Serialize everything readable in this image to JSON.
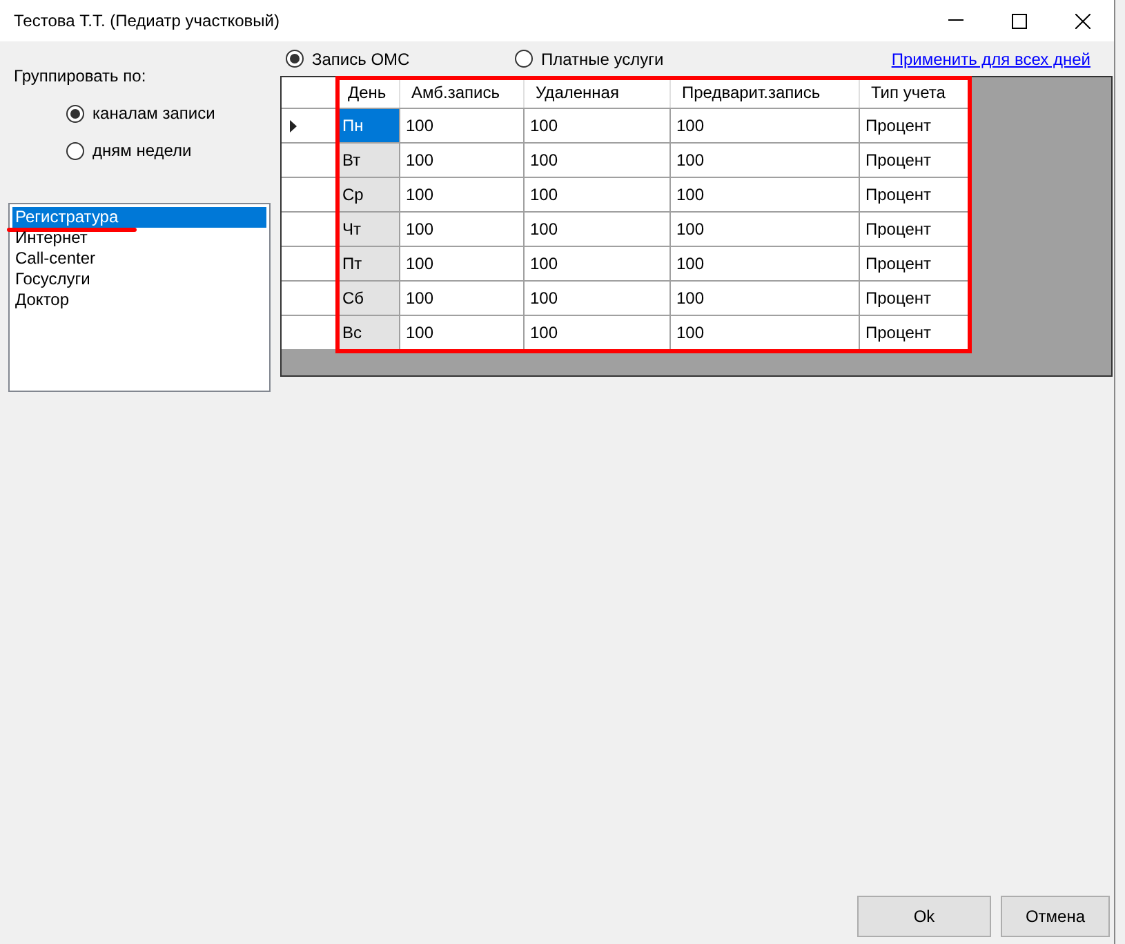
{
  "window": {
    "title": "Тестова Т.Т. (Педиатр участковый)"
  },
  "group_by": {
    "label": "Группировать по:",
    "options": [
      {
        "label": "каналам записи",
        "selected": true
      },
      {
        "label": "дням недели",
        "selected": false
      }
    ]
  },
  "channels": [
    {
      "label": "Регистратура",
      "selected": true
    },
    {
      "label": "Интернет",
      "selected": false
    },
    {
      "label": "Call-center",
      "selected": false
    },
    {
      "label": "Госуслуги",
      "selected": false
    },
    {
      "label": "Доктор",
      "selected": false
    }
  ],
  "payment": [
    {
      "label": "Запись ОМС",
      "selected": true
    },
    {
      "label": "Платные услуги",
      "selected": false
    }
  ],
  "apply_link": "Применить для всех дней",
  "table": {
    "columns": [
      "День",
      "Амб.запись",
      "Удаленная",
      "Предварит.запись",
      "Тип учета"
    ],
    "rows": [
      {
        "current": true,
        "selected": true,
        "cells": [
          "Пн",
          "100",
          "100",
          "100",
          "Процент"
        ]
      },
      {
        "current": false,
        "selected": false,
        "cells": [
          "Вт",
          "100",
          "100",
          "100",
          "Процент"
        ]
      },
      {
        "current": false,
        "selected": false,
        "cells": [
          "Ср",
          "100",
          "100",
          "100",
          "Процент"
        ]
      },
      {
        "current": false,
        "selected": false,
        "cells": [
          "Чт",
          "100",
          "100",
          "100",
          "Процент"
        ]
      },
      {
        "current": false,
        "selected": false,
        "cells": [
          "Пт",
          "100",
          "100",
          "100",
          "Процент"
        ]
      },
      {
        "current": false,
        "selected": false,
        "cells": [
          "Сб",
          "100",
          "100",
          "100",
          "Процент"
        ]
      },
      {
        "current": false,
        "selected": false,
        "cells": [
          "Вс",
          "100",
          "100",
          "100",
          "Процент"
        ]
      }
    ]
  },
  "buttons": [
    "Ok",
    "Отмена"
  ]
}
